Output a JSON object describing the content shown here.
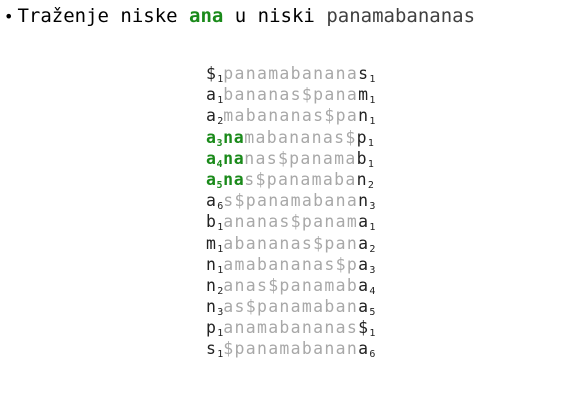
{
  "heading": {
    "bullet": "•",
    "prefix": "Traženje niske ",
    "pattern": "ana",
    "middle": " u niski ",
    "text": "panamabananas"
  },
  "rows": [
    {
      "first": "$",
      "first_rank": "1",
      "match": "",
      "match_rank": "",
      "middle": "panamabanana",
      "last": "s",
      "last_rank": "1"
    },
    {
      "first": "a",
      "first_rank": "1",
      "match": "",
      "match_rank": "",
      "middle": "bananas$pana",
      "last": "m",
      "last_rank": "1"
    },
    {
      "first": "a",
      "first_rank": "2",
      "match": "",
      "match_rank": "",
      "middle": "mabananas$pa",
      "last": "n",
      "last_rank": "1"
    },
    {
      "first": "a",
      "first_rank": "3",
      "match": "na",
      "match_rank": "",
      "middle": "mabananas$",
      "last": "p",
      "last_rank": "1"
    },
    {
      "first": "a",
      "first_rank": "4",
      "match": "na",
      "match_rank": "",
      "middle": "nas$panama",
      "last": "b",
      "last_rank": "1"
    },
    {
      "first": "a",
      "first_rank": "5",
      "match": "na",
      "match_rank": "",
      "middle": "s$panamaba",
      "last": "n",
      "last_rank": "2"
    },
    {
      "first": "a",
      "first_rank": "6",
      "match": "",
      "match_rank": "",
      "middle": "s$panamabana",
      "last": "n",
      "last_rank": "3"
    },
    {
      "first": "b",
      "first_rank": "1",
      "match": "",
      "match_rank": "",
      "middle": "ananas$panam",
      "last": "a",
      "last_rank": "1"
    },
    {
      "first": "m",
      "first_rank": "1",
      "match": "",
      "match_rank": "",
      "middle": "abananas$pan",
      "last": "a",
      "last_rank": "2"
    },
    {
      "first": "n",
      "first_rank": "1",
      "match": "",
      "match_rank": "",
      "middle": "amabananas$p",
      "last": "a",
      "last_rank": "3"
    },
    {
      "first": "n",
      "first_rank": "2",
      "match": "",
      "match_rank": "",
      "middle": "anas$panamab",
      "last": "a",
      "last_rank": "4"
    },
    {
      "first": "n",
      "first_rank": "3",
      "match": "",
      "match_rank": "",
      "middle": "as$panamaban",
      "last": "a",
      "last_rank": "5"
    },
    {
      "first": "p",
      "first_rank": "1",
      "match": "",
      "match_rank": "",
      "middle": "anamabananas",
      "last": "$",
      "last_rank": "1"
    },
    {
      "first": "s",
      "first_rank": "1",
      "match": "",
      "match_rank": "",
      "middle": "$panamabanan",
      "last": "a",
      "last_rank": "6"
    }
  ],
  "colors": {
    "highlight": "#1a8a1a",
    "dark_text": "#222222",
    "light_text": "#a8a8a8"
  }
}
